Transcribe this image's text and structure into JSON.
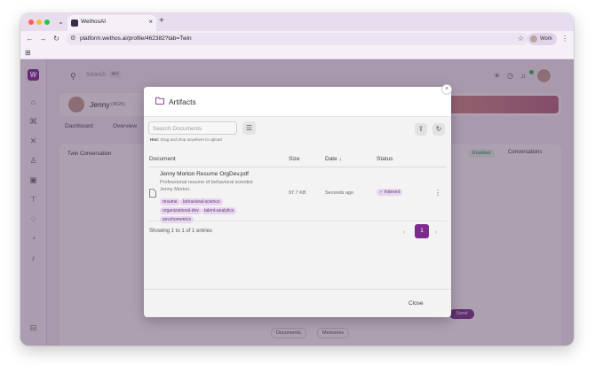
{
  "browser": {
    "tab_title": "WethosAI",
    "url": "platform.wethos.ai/profile/462382?tab=Twin",
    "profile_label": "Work"
  },
  "app": {
    "search_placeholder": "Search",
    "search_shortcut": "⌘K",
    "profile_name": "Jenny",
    "profile_id": "(4626)",
    "tabs": [
      "Dashboard",
      "Overview"
    ],
    "twin_title": "Twin Conversation",
    "enabled_label": "Enabled",
    "conversations_label": "Conversations",
    "send_label": "Send",
    "bottom_tabs": [
      "Documents",
      "Memories"
    ]
  },
  "modal": {
    "title": "Artifacts",
    "search_placeholder": "Search Documents",
    "hint_label": "Hint:",
    "hint_text": "Drag and drop anywhere to upload",
    "columns": [
      "Document",
      "Size",
      "Date ↓",
      "Status"
    ],
    "rows": [
      {
        "name": "Jenny Morton Resume OrgDev.pdf",
        "description": "Professional resume of behavioral scientist Jenny Morton.",
        "tags": [
          "resume",
          "behavioral-science",
          "organizational-dev",
          "talent-analytics",
          "psychometrics"
        ],
        "size": "97.7 KB",
        "date": "Seconds ago",
        "status": "✓ Indexed"
      }
    ],
    "entries_text": "Showing 1 to 1 of 1 entries",
    "current_page": "1",
    "close_label": "Close"
  },
  "colors": {
    "accent": "#7b2c8c",
    "overlay": "#3c1e46",
    "tag_bg": "#e6d6ee"
  },
  "icons": {
    "modal_title": "folder-icon",
    "filter": "sliders-icon",
    "upload": "cloud-upload-icon",
    "refresh": "refresh-icon",
    "row_menu": "kebab-icon"
  }
}
